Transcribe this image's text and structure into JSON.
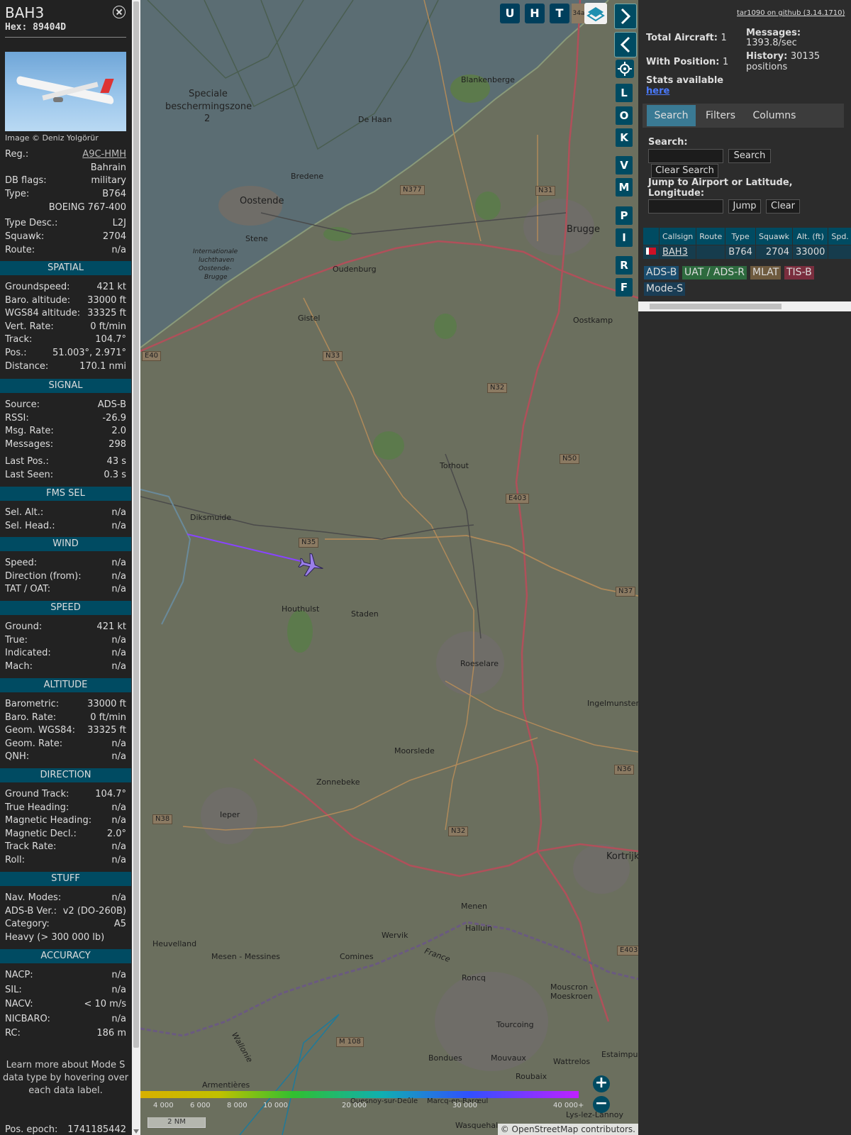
{
  "info": {
    "callsign": "BAH3",
    "hex_label": "Hex:",
    "hex": "89404D",
    "image_credit": "Image © Deniz Yolgörür",
    "rows_top": [
      {
        "k": "Reg.:",
        "v": "A9C-HMH"
      },
      {
        "k": "",
        "v": "Bahrain"
      },
      {
        "k": "DB flags:",
        "v": "military"
      },
      {
        "k": "Type:",
        "v": "B764"
      },
      {
        "k": "",
        "v": "BOEING 767-400"
      },
      {
        "k": "Type Desc.:",
        "v": "L2J"
      },
      {
        "k": "Squawk:",
        "v": "2704"
      },
      {
        "k": "Route:",
        "v": "n/a"
      }
    ],
    "sections": [
      {
        "title": "SPATIAL",
        "rows": [
          {
            "k": "Groundspeed:",
            "v": "421 kt"
          },
          {
            "k": "Baro. altitude:",
            "v": "33000 ft"
          },
          {
            "k": "WGS84 altitude:",
            "v": "33325 ft"
          },
          {
            "k": "Vert. Rate:",
            "v": "0 ft/min"
          },
          {
            "k": "Track:",
            "v": "104.7°"
          },
          {
            "k": "Pos.:",
            "v": "51.003°, 2.971°"
          },
          {
            "k": "Distance:",
            "v": "170.1 nmi"
          }
        ]
      },
      {
        "title": "SIGNAL",
        "rows": [
          {
            "k": "Source:",
            "v": "ADS-B"
          },
          {
            "k": "RSSI:",
            "v": "-26.9"
          },
          {
            "k": "Msg. Rate:",
            "v": "2.0"
          },
          {
            "k": "Messages:",
            "v": "298"
          },
          {
            "k": "Last Pos.:",
            "v": "43 s"
          },
          {
            "k": "Last Seen:",
            "v": "0.3 s"
          }
        ]
      },
      {
        "title": "FMS SEL",
        "rows": [
          {
            "k": "Sel. Alt.:",
            "v": "n/a"
          },
          {
            "k": "Sel. Head.:",
            "v": "n/a"
          }
        ]
      },
      {
        "title": "WIND",
        "rows": [
          {
            "k": "Speed:",
            "v": "n/a"
          },
          {
            "k": "Direction (from):",
            "v": "n/a"
          },
          {
            "k": "TAT / OAT:",
            "v": "n/a"
          }
        ]
      },
      {
        "title": "SPEED",
        "rows": [
          {
            "k": "Ground:",
            "v": "421 kt"
          },
          {
            "k": "True:",
            "v": "n/a"
          },
          {
            "k": "Indicated:",
            "v": "n/a"
          },
          {
            "k": "Mach:",
            "v": "n/a"
          }
        ]
      },
      {
        "title": "ALTITUDE",
        "rows": [
          {
            "k": "Barometric:",
            "v": "33000 ft"
          },
          {
            "k": "Baro. Rate:",
            "v": "0 ft/min"
          },
          {
            "k": "Geom. WGS84:",
            "v": "33325 ft"
          },
          {
            "k": "Geom. Rate:",
            "v": "n/a"
          },
          {
            "k": "QNH:",
            "v": "n/a"
          }
        ]
      },
      {
        "title": "DIRECTION",
        "rows": [
          {
            "k": "Ground Track:",
            "v": "104.7°"
          },
          {
            "k": "True Heading:",
            "v": "n/a"
          },
          {
            "k": "Magnetic Heading:",
            "v": "n/a"
          },
          {
            "k": "Magnetic Decl.:",
            "v": "2.0°"
          },
          {
            "k": "Track Rate:",
            "v": "n/a"
          },
          {
            "k": "Roll:",
            "v": "n/a"
          }
        ]
      },
      {
        "title": "STUFF",
        "rows": [
          {
            "k": "Nav. Modes:",
            "v": "n/a"
          },
          {
            "k": "ADS-B Ver.:",
            "v": "v2 (DO-260B)"
          },
          {
            "k": "Category:",
            "v": "A5"
          },
          {
            "k": "Heavy (> 300 000 lb)",
            "v": ""
          }
        ]
      },
      {
        "title": "ACCURACY",
        "rows": [
          {
            "k": "NACP:",
            "v": "n/a"
          },
          {
            "k": "SIL:",
            "v": "n/a"
          },
          {
            "k": "NACV:",
            "v": "< 10 m/s"
          },
          {
            "k": "NICBARO:",
            "v": "n/a"
          },
          {
            "k": "RC:",
            "v": "186 m"
          }
        ]
      }
    ],
    "note": "Learn more about Mode S data type by hovering over each data label.",
    "epoch_label": "Pos. epoch:",
    "epoch_value": "1741185442"
  },
  "map": {
    "top_buttons": [
      "U",
      "H",
      "T"
    ],
    "side_buttons": [
      "L",
      "O",
      "K",
      "V",
      "M",
      "P",
      "I",
      "R",
      "F"
    ],
    "labels": {
      "speciale": "Speciale",
      "beschermingszone": "beschermingszone",
      "two": "2",
      "blankenberge": "Blankenberge",
      "dehaan": "De Haan",
      "bredene": "Bredene",
      "oostende": "Oostende",
      "stene": "Stene",
      "airport1": "Internationale",
      "airport2": "luchthaven",
      "airport3": "Oostende-",
      "airport4": "Brugge",
      "oudenburg": "Oudenburg",
      "brugge": "Brugge",
      "gistel": "Gistel",
      "oostkamp": "Oostkamp",
      "torhout": "Torhout",
      "diksmuide": "Diksmuide",
      "houthulst": "Houthulst",
      "staden": "Staden",
      "roeselare": "Roeselare",
      "ingelmunster": "Ingelmunster",
      "moorslede": "Moorslede",
      "zonnebeke": "Zonnebeke",
      "ieper": "Ieper",
      "kortrijk": "Kortrijk",
      "menen": "Menen",
      "halluin": "Halluin",
      "wervik": "Wervik",
      "comines": "Comines",
      "heuvelland": "Heuvelland",
      "mesen": "Mesen - Messines",
      "roncq": "Roncq",
      "mouscron": "Mouscron -",
      "moeskroen": "Moeskroen",
      "tourcoing": "Tourcoing",
      "bondues": "Bondues",
      "mouvaux": "Mouvaux",
      "roubaix": "Roubaix",
      "wattrelos": "Wattrelos",
      "estaimpuis": "Estaimpuis",
      "armentieres": "Armentières",
      "quesnoy": "Quesnoy-sur-Deûle",
      "marcq": "Marcq-en-Barœul",
      "wasquehal": "Wasquehal",
      "lys": "Lys-lez-Lannoy",
      "wallonie": "Wallonie",
      "france": "France"
    },
    "roads": [
      "N377",
      "N31",
      "N33",
      "N32",
      "N50",
      "E403",
      "N35",
      "N37",
      "N36",
      "N38",
      "N32",
      "E403",
      "M 108",
      "E40"
    ],
    "altitude_scale": [
      "4 000",
      "6 000",
      "8 000",
      "10 000",
      "20 000",
      "30 000",
      "40 000+"
    ],
    "scale_label": "2 NM",
    "attribution": "© OpenStreetMap contributors."
  },
  "right": {
    "github_link": "tar1090 on github (3.14.1710)",
    "total_aircraft_label": "Total Aircraft:",
    "total_aircraft": "1",
    "with_position_label": "With Position:",
    "with_position": "1",
    "messages_label": "Messages:",
    "messages_rate": "1393.8/sec",
    "history_label": "History:",
    "history_value": "30135",
    "history_unit": "positions",
    "stats_label": "Stats available",
    "stats_link": "here",
    "tabs": [
      "Search",
      "Filters",
      "Columns"
    ],
    "search_label": "Search:",
    "search_button": "Search",
    "clear_search_button": "Clear Search",
    "jump_label": "Jump to Airport or Latitude, Longitude:",
    "jump_button": "Jump",
    "clear_button": "Clear",
    "table_headers": [
      "",
      "Callsign",
      "Route",
      "Type",
      "Squawk",
      "Alt. (ft)",
      "Spd."
    ],
    "table_row": {
      "callsign": "BAH3",
      "route": "",
      "type": "B764",
      "squawk": "2704",
      "alt": "33000",
      "spd": ""
    },
    "sources": [
      {
        "label": "ADS-B",
        "color": "#1a4d6e"
      },
      {
        "label": "UAT / ADS-R",
        "color": "#2d6a3e"
      },
      {
        "label": "MLAT",
        "color": "#6e5a3e"
      },
      {
        "label": "TIS-B",
        "color": "#7a2e3e"
      },
      {
        "label": "Mode-S",
        "color": "#1a3d55"
      }
    ]
  },
  "colors": {
    "section_bg": "#004b62",
    "map_land": "#6b6f5e",
    "map_sea": "#5b6d73",
    "track_line": "#8844ff"
  }
}
